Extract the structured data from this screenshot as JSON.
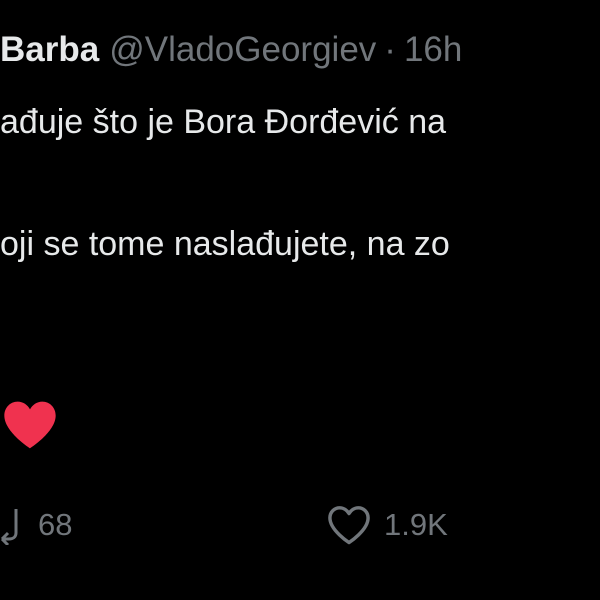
{
  "tweet": {
    "display_name": "Barba",
    "handle": "@VladoGeorgiev",
    "separator": "·",
    "time": "16h",
    "lines": [
      "ađuje što je Bora Đorđević na",
      "oji se tome naslađujete, na zo"
    ],
    "emoji": "red-heart-emoji"
  },
  "actions": {
    "retweet": {
      "icon": "retweet-icon",
      "count": "68"
    },
    "like": {
      "icon": "heart-outline-icon",
      "count": "1.9K"
    }
  },
  "colors": {
    "background": "#000000",
    "text": "#e7e9ea",
    "secondary": "#71767b",
    "heart": "#f0324f"
  }
}
